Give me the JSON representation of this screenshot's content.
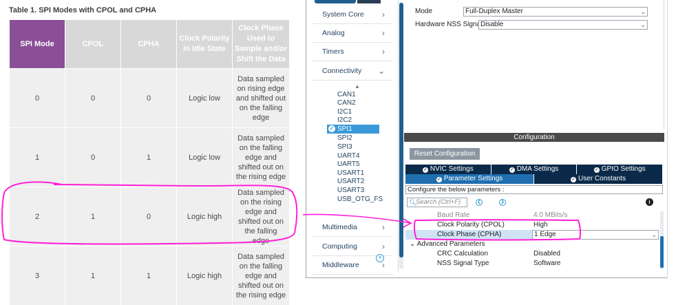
{
  "table": {
    "title": "Table 1. SPI Modes with CPOL and CPHA",
    "headers": [
      "SPI Mode",
      "CPOL",
      "CPHA",
      "Clock Polarity in Idle State",
      "Clock Phase Used to Sample and/or Shift the Data"
    ],
    "rows": [
      {
        "mode": "0",
        "cpol": "0",
        "cpha": "0",
        "idle": "Logic low",
        "phase": "Data sampled on rising edge and shifted out on the falling edge"
      },
      {
        "mode": "1",
        "cpol": "0",
        "cpha": "1",
        "idle": "Logic low",
        "phase": "Data sampled on the falling edge and shifted out on the rising edge"
      },
      {
        "mode": "2",
        "cpol": "1",
        "cpha": "0",
        "idle": "Logic high",
        "phase": "Data sampled on the rising edge and shifted out on the falling edge"
      },
      {
        "mode": "3",
        "cpol": "1",
        "cpha": "1",
        "idle": "Logic high",
        "phase": "Data sampled on the falling edge and shifted out on the rising edge"
      }
    ],
    "header_highlight_color": "#8a4f97"
  },
  "categories": {
    "items": [
      {
        "label": "System Core"
      },
      {
        "label": "Analog"
      },
      {
        "label": "Timers"
      },
      {
        "label": "Connectivity"
      },
      {
        "label": "Multimedia"
      },
      {
        "label": "Computing"
      },
      {
        "label": "Middleware"
      }
    ],
    "connectivity_items": [
      "CAN1",
      "CAN2",
      "I2C1",
      "I2C2",
      "SPI1",
      "SPI2",
      "SPI3",
      "UART4",
      "UART5",
      "USART1",
      "USART2",
      "USART3",
      "USB_OTG_FS"
    ],
    "selected": "SPI1"
  },
  "mode": {
    "mode_label": "Mode",
    "mode_value": "Full-Duplex Master",
    "nss_label": "Hardware NSS Signal",
    "nss_value": "Disable"
  },
  "configuration": {
    "header": "Configuration",
    "reset_button": "Reset Configuration",
    "tabs_row1": [
      "NVIC Settings",
      "DMA Settings",
      "GPIO Settings"
    ],
    "tabs_row2": [
      "Parameter Settings",
      "User Constants"
    ],
    "active_tab": "Parameter Settings",
    "configure_text": "Configure the below parameters :",
    "search_placeholder": "Search (Ctrl+F)",
    "params": [
      {
        "name": "Baud Rate",
        "value": "4.0 MBits/s"
      },
      {
        "name": "Clock Polarity (CPOL)",
        "value": "High"
      },
      {
        "name": "Clock Phase (CPHA)",
        "value": "1 Edge"
      },
      {
        "name": "Advanced Parameters",
        "value": ""
      },
      {
        "name": "CRC Calculation",
        "value": "Disabled"
      },
      {
        "name": "NSS Signal Type",
        "value": "Software"
      }
    ]
  },
  "colors": {
    "annotation": "#ff1fd8",
    "accent": "#3a9ad9",
    "nav_dark": "#0b2a4a"
  }
}
